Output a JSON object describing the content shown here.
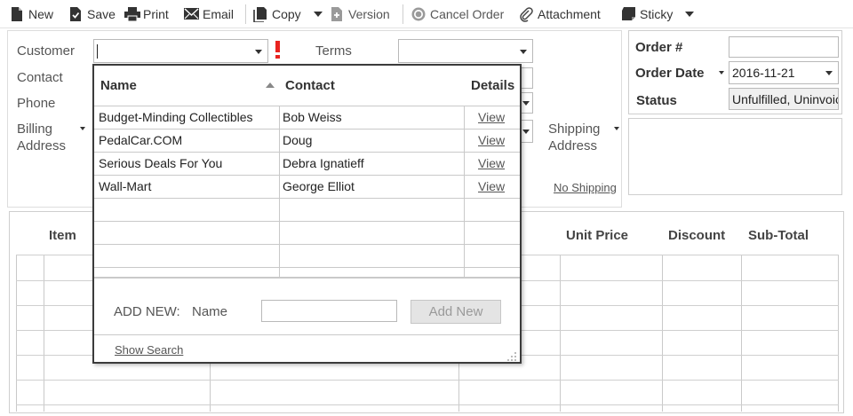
{
  "toolbar": {
    "new": "New",
    "save": "Save",
    "print": "Print",
    "email": "Email",
    "copy": "Copy",
    "version": "Version",
    "cancel_order": "Cancel Order",
    "attachment": "Attachment",
    "sticky": "Sticky"
  },
  "form": {
    "customer_label": "Customer",
    "customer_value": "",
    "contact_label": "Contact",
    "phone_label": "Phone",
    "billing_label_1": "Billing",
    "billing_label_2": "Address",
    "terms_label": "Terms",
    "terms_value": "",
    "shipping_label_1": "Shipping",
    "shipping_label_2": "Address",
    "no_shipping": "No Shipping",
    "order_number_label": "Order #",
    "order_number_value": "",
    "order_date_label": "Order Date",
    "order_date_value": "2016-11-21",
    "status_label": "Status",
    "status_value": "Unfulfilled, Uninvoiced"
  },
  "grid": {
    "columns": [
      "Item",
      "Unit Price",
      "Discount",
      "Sub-Total"
    ]
  },
  "popup": {
    "headers": {
      "name": "Name",
      "contact": "Contact",
      "details": "Details"
    },
    "rows": [
      {
        "name": "Budget-Minding Collectibles",
        "contact": "Bob Weiss",
        "details": "View"
      },
      {
        "name": "PedalCar.COM",
        "contact": "Doug",
        "details": "View"
      },
      {
        "name": "Serious Deals For You",
        "contact": "Debra Ignatieff",
        "details": "View"
      },
      {
        "name": "Wall-Mart",
        "contact": "George Elliot",
        "details": "View"
      }
    ],
    "add_new_label": "ADD NEW:",
    "name_label": "Name",
    "name_value": "",
    "add_new_button": "Add New",
    "show_search": "Show Search"
  },
  "colors": {
    "required": "#e8231f",
    "disabled_button_bg": "#e4e4e4"
  }
}
